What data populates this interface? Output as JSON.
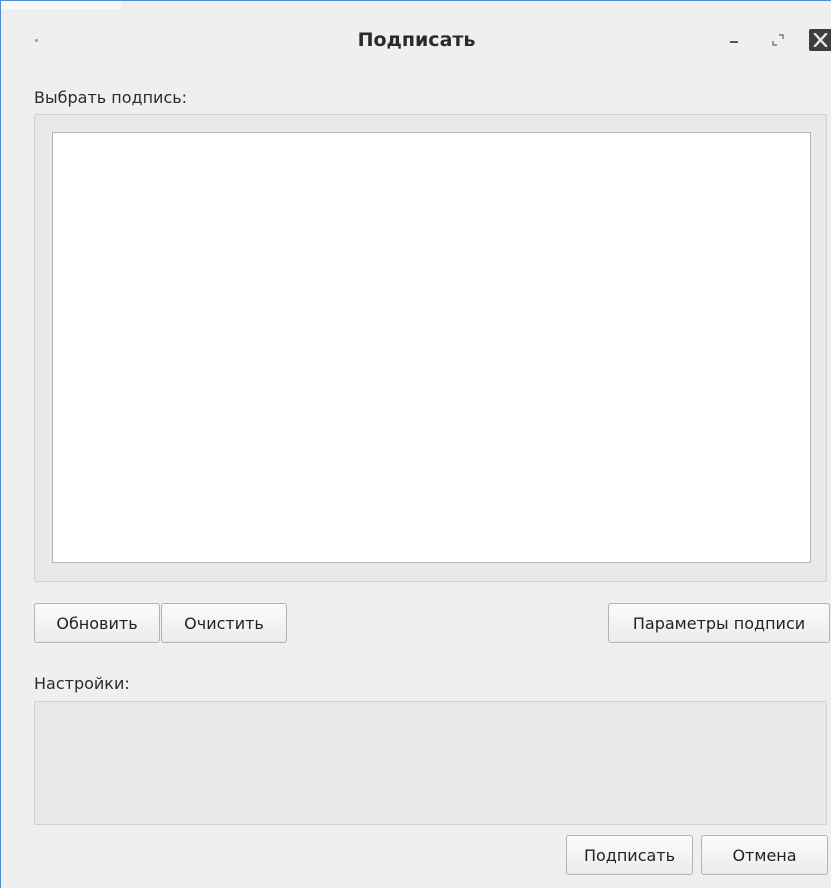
{
  "window": {
    "title": "Подписать",
    "controls": [
      "menu-icon",
      "minimize-icon",
      "maximize-icon",
      "close-icon"
    ]
  },
  "signature_section": {
    "label": "Выбрать подпись:",
    "items": []
  },
  "actions": {
    "refresh_label": "Обновить",
    "clear_label": "Очистить",
    "params_label": "Параметры подписи"
  },
  "settings_section": {
    "label": "Настройки:"
  },
  "footer": {
    "sign_label": "Подписать",
    "cancel_label": "Отмена"
  },
  "colors": {
    "window_bg": "#efefef",
    "border_accent": "#4d8fd6",
    "list_bg": "#ffffff"
  }
}
